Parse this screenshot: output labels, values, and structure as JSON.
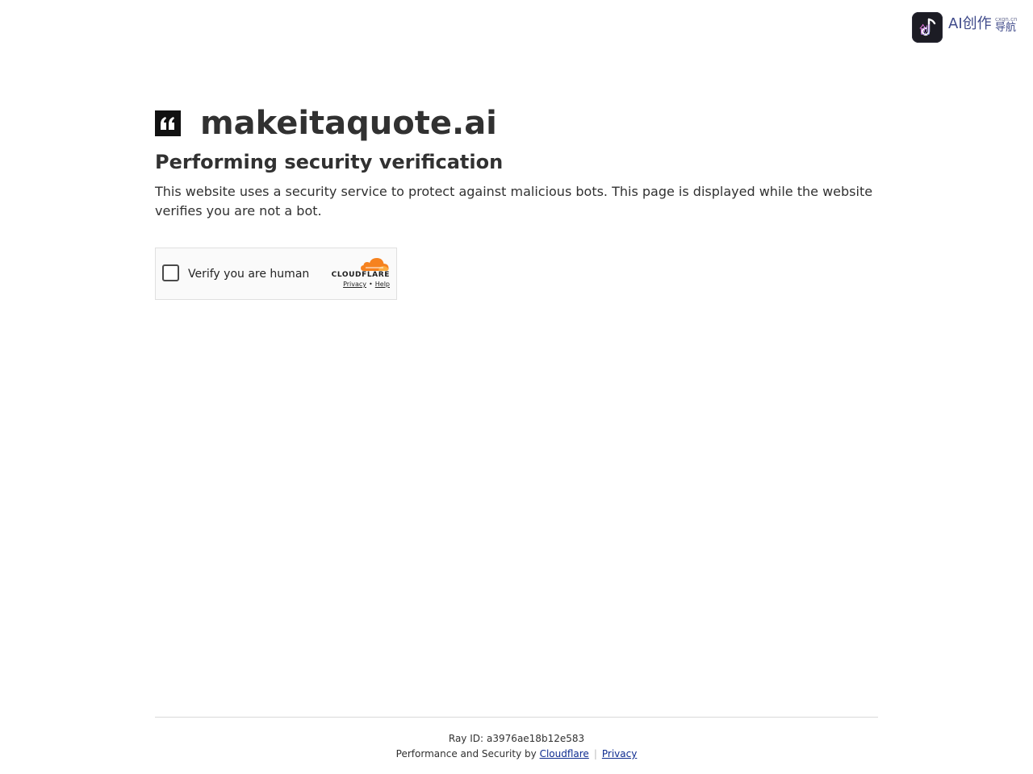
{
  "corner_brand": {
    "logo_icon": "creation-app-icon",
    "logo_glyph": "创",
    "main_text": "AI创作",
    "small_text": "cxgn.cn",
    "sub_text": "导航",
    "text_color": "#3f4a8a"
  },
  "site": {
    "logo_icon": "quote-mark-icon",
    "title": "makeitaquote.ai"
  },
  "content": {
    "heading": "Performing security verification",
    "description": "This website uses a security service to protect against malicious bots. This page is displayed while the website verifies you are not a bot."
  },
  "widget": {
    "checkbox_label": "Verify you are human",
    "brand_icon": "cloudflare-cloud-icon",
    "brand_text": "CLOUDFLARE",
    "privacy_link": "Privacy",
    "separator": "•",
    "help_link": "Help",
    "brand_color": "#f6821f"
  },
  "footer": {
    "ray_label": "Ray ID:",
    "ray_id": "a3976ae18b12e583",
    "performance_text": "Performance and Security by",
    "cloudflare_link": "Cloudflare",
    "separator": "|",
    "privacy_link": "Privacy",
    "link_color": "#0d2b8f"
  }
}
